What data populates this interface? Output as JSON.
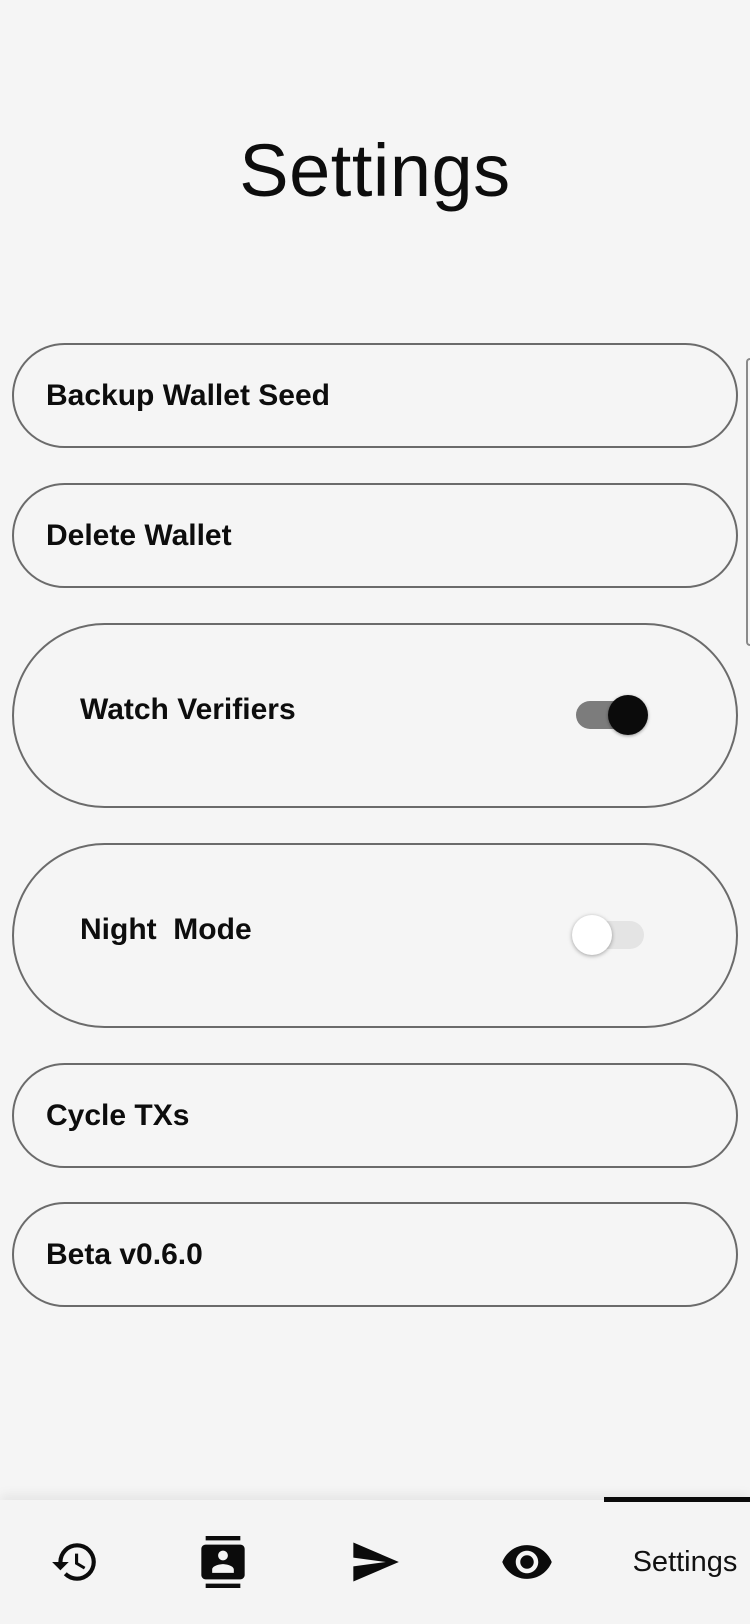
{
  "header": {
    "title": "Settings"
  },
  "settings": {
    "backup_label": "Backup Wallet Seed",
    "delete_label": "Delete Wallet",
    "watch_verifiers": {
      "label": "Watch Verifiers",
      "enabled": true
    },
    "night_mode": {
      "label": "Night  Mode",
      "enabled": false
    },
    "cycle_label": "Cycle TXs",
    "version_label": "Beta v0.6.0"
  },
  "nav": {
    "items": [
      {
        "icon": "history-icon"
      },
      {
        "icon": "contacts-icon"
      },
      {
        "icon": "send-icon"
      },
      {
        "icon": "eye-icon"
      },
      {
        "label": "Settings",
        "active": true
      }
    ]
  },
  "colors": {
    "background": "#f5f5f5",
    "text": "#0d0d0d",
    "border": "#6b6b6b",
    "toggle_on_thumb": "#0b0b0b",
    "toggle_on_track": "#7c7c7c",
    "toggle_off_thumb": "#ffffff",
    "toggle_off_track": "#e4e4e4"
  }
}
